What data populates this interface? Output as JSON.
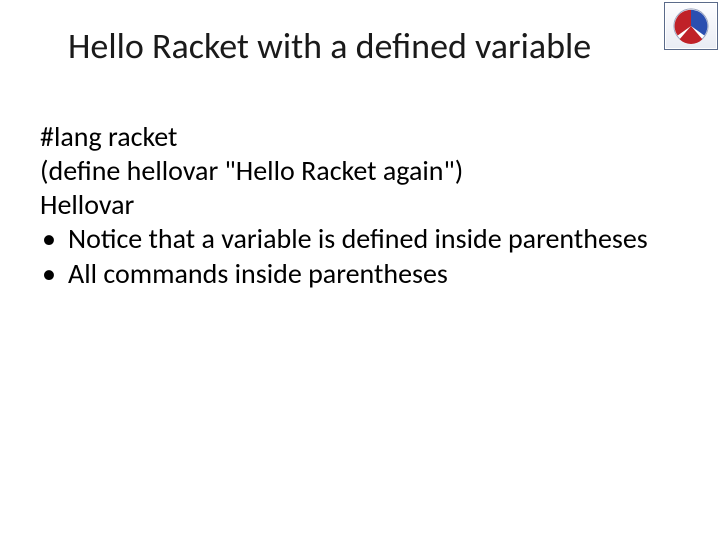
{
  "title": "Hello Racket with a defined variable",
  "code": {
    "line1": "#lang racket",
    "line2": "(define hellovar \"Hello Racket again\")",
    "line3": "Hellovar"
  },
  "bullets": [
    "Notice that a variable is defined inside parentheses",
    "All commands inside parentheses"
  ],
  "logo": {
    "name": "racket-logo"
  }
}
